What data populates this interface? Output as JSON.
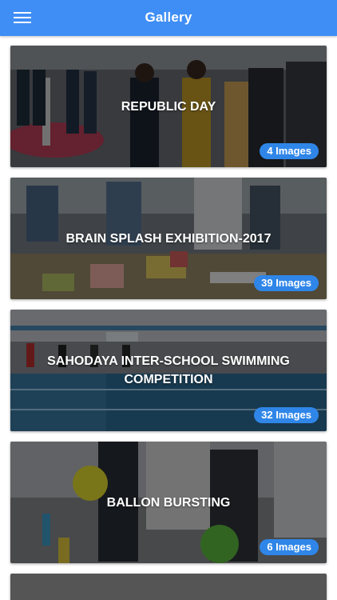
{
  "header": {
    "title": "Gallery",
    "menu_icon": "hamburger-menu-icon",
    "background_color": "#3f8ef5"
  },
  "albums": [
    {
      "title": "REPUBLIC DAY",
      "count_label": "4 Images"
    },
    {
      "title": "BRAIN SPLASH EXHIBITION-2017",
      "count_label": "39 Images"
    },
    {
      "title": "SAHODAYA INTER-SCHOOL SWIMMING COMPETITION",
      "count_label": "32 Images"
    },
    {
      "title": "BALLON BURSTING",
      "count_label": "6 Images"
    }
  ],
  "colors": {
    "badge": "#2f86e8",
    "overlay": "rgba(0,0,0,0.48)"
  }
}
